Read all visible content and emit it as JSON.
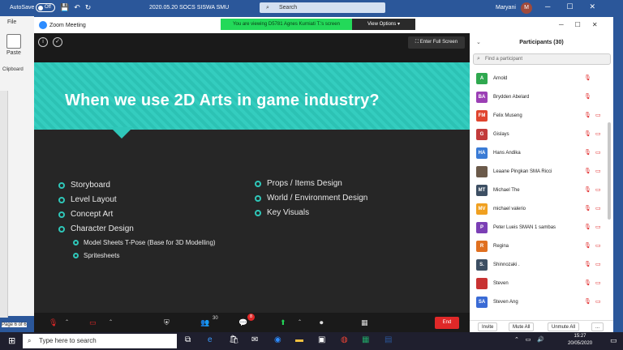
{
  "word": {
    "autosave_label": "AutoSave",
    "autosave_state": "Off",
    "doc_title": "2020.05.20 SOCS SISWA SMU",
    "search_placeholder": "Search",
    "user": "Maryani",
    "user_initial": "M",
    "tab_file": "File",
    "paste_label": "Paste",
    "clipboard_label": "Clipboard",
    "page_label": "Page 6 of 6"
  },
  "zoom": {
    "window_title": "Zoom Meeting",
    "viewing_banner": "You are viewing D5781 Agnes Kurniati T.'s screen",
    "view_options": "View Options ▾",
    "enter_full_screen": "Enter Full Screen",
    "toolbar_participant_count": "30",
    "chat_badge": "8",
    "end_label": "End"
  },
  "slide": {
    "title": "When we use 2D Arts in game industry?",
    "left_items": [
      "Storyboard",
      "Level Layout",
      "Concept Art",
      "Character Design"
    ],
    "sub_items": [
      "Model Sheets T-Pose (Base for 3D Modelling)",
      "Spritesheets"
    ],
    "right_items": [
      "Props / Items Design",
      "World / Environment Design",
      "Key Visuals"
    ]
  },
  "participants": {
    "header": "Participants (30)",
    "find_placeholder": "Find a participant",
    "list": [
      {
        "initials": "A",
        "name": "Arnold",
        "color": "#2fa84f",
        "cam": false
      },
      {
        "initials": "BA",
        "name": "Brydden Abelard",
        "color": "#9b3fb5",
        "cam": false
      },
      {
        "initials": "FM",
        "name": "Felix Museng",
        "color": "#e0452f",
        "cam": true
      },
      {
        "initials": "G",
        "name": "Gislays",
        "color": "#c23b3b",
        "cam": true
      },
      {
        "initials": "HA",
        "name": "Hans Andika",
        "color": "#3a7bd5",
        "cam": true
      },
      {
        "initials": "",
        "name": "Leaane Pingkan SMA Ricci",
        "color": "#6b5a4a",
        "cam": true
      },
      {
        "initials": "MT",
        "name": "Michael The",
        "color": "#3d4f63",
        "cam": true
      },
      {
        "initials": "MV",
        "name": "michael valerio",
        "color": "#f0a020",
        "cam": true
      },
      {
        "initials": "P",
        "name": "Peter Lueis SMAN 1 sambas",
        "color": "#7b3fb5",
        "cam": true
      },
      {
        "initials": "R",
        "name": "Regina",
        "color": "#e07020",
        "cam": true
      },
      {
        "initials": "S.",
        "name": "Shinnozaki .",
        "color": "#3d4f63",
        "cam": true
      },
      {
        "initials": "",
        "name": "Steven",
        "color": "#c83232",
        "cam": true
      },
      {
        "initials": "SA",
        "name": "Steven Ang",
        "color": "#3a6bd5",
        "cam": true
      }
    ],
    "invite_label": "Invite",
    "mute_all_label": "Mute All",
    "unmute_all_label": "Unmute All",
    "more_label": "..."
  },
  "taskbar": {
    "search_placeholder": "Type here to search",
    "time": "15:27",
    "date": "20/05/2020"
  }
}
